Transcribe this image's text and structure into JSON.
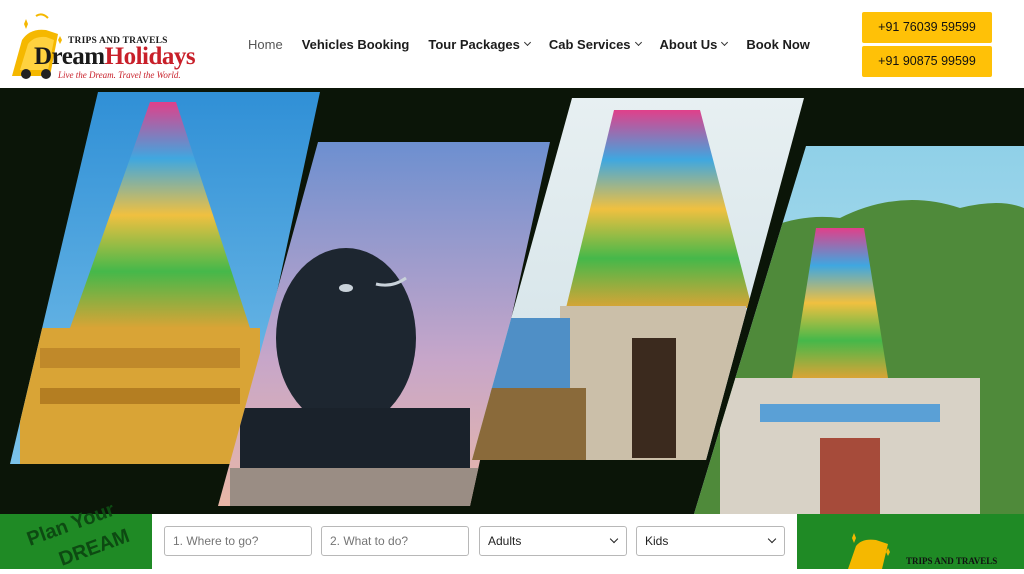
{
  "brand": {
    "top_line": "TRIPS AND TRAVELS",
    "name_part1": "Dream",
    "name_part2": "Holidays",
    "tagline": "Live the Dream. Travel the World.",
    "footer_logo_text": "TRIPS AND TRAVELS"
  },
  "nav": {
    "items": [
      {
        "label": "Home",
        "active": true,
        "dropdown": false
      },
      {
        "label": "Vehicles Booking",
        "active": false,
        "dropdown": false
      },
      {
        "label": "Tour Packages",
        "active": false,
        "dropdown": true
      },
      {
        "label": "Cab Services",
        "active": false,
        "dropdown": true
      },
      {
        "label": "About Us",
        "active": false,
        "dropdown": true
      },
      {
        "label": "Book Now",
        "active": false,
        "dropdown": false
      }
    ]
  },
  "contact": {
    "phone1": "+91 76039 59599",
    "phone2": "+91 90875 99599"
  },
  "plan": {
    "line1": "Plan Your",
    "line2": "DREAM"
  },
  "search_form": {
    "where_placeholder": "1. Where to go?",
    "what_placeholder": "2. What to do?",
    "adults_value": "Adults",
    "kids_value": "Kids"
  },
  "colors": {
    "accent_yellow": "#ffc107",
    "green_bar": "#1f8a25",
    "brand_red": "#c8202a",
    "hero_bg": "#0b1508"
  }
}
